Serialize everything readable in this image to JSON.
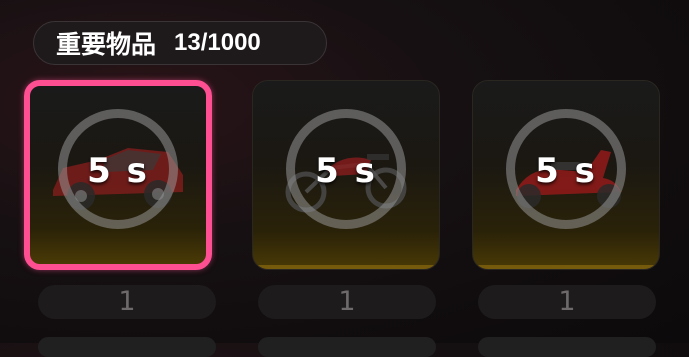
{
  "header": {
    "title": "重要物品",
    "count": "13/1000"
  },
  "items": [
    {
      "icon": "car-icon",
      "timer": "5 s",
      "quantity": "1",
      "selected": true,
      "accent": "#ff4f93"
    },
    {
      "icon": "motorcycle-icon",
      "timer": "5 s",
      "quantity": "1",
      "selected": false
    },
    {
      "icon": "scooter-icon",
      "timer": "5 s",
      "quantity": "1",
      "selected": false
    }
  ],
  "colors": {
    "selection_border": "#ff4f93",
    "card_glow": "#8a6a10",
    "timer_text": "#ffffff"
  }
}
